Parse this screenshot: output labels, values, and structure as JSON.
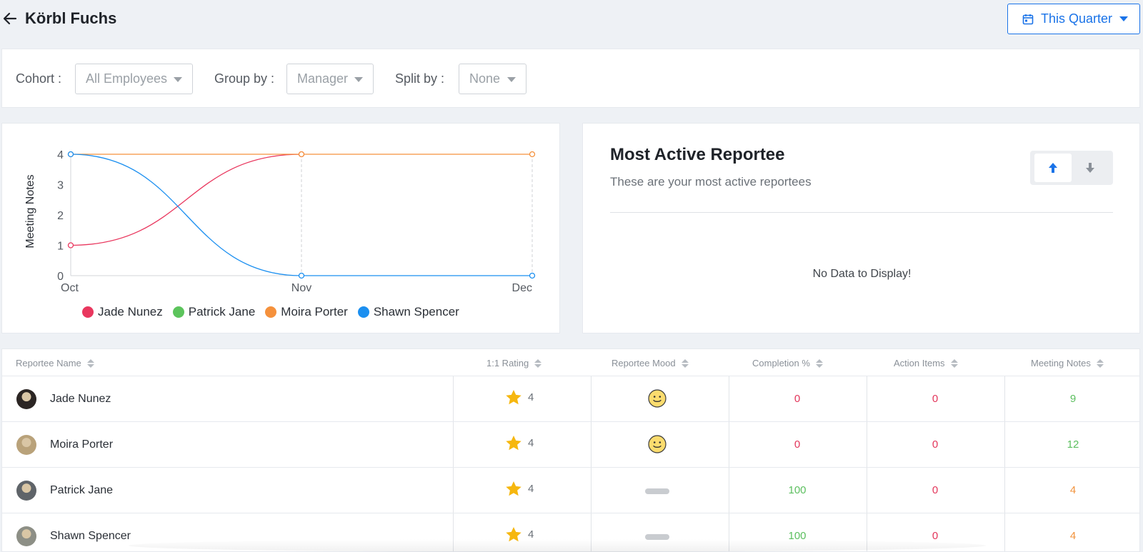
{
  "header": {
    "title": "Körbl Fuchs",
    "date_range": "This Quarter"
  },
  "filters": {
    "cohort": {
      "label": "Cohort :",
      "value": "All Employees"
    },
    "group_by": {
      "label": "Group by :",
      "value": "Manager"
    },
    "split_by": {
      "label": "Split by :",
      "value": "None"
    }
  },
  "chart_data": {
    "type": "line",
    "ylabel": "Meeting Notes",
    "x": [
      "Oct",
      "Nov",
      "Dec"
    ],
    "yticks": [
      "0",
      "1",
      "2",
      "3",
      "4"
    ],
    "ylim": [
      0,
      4
    ],
    "series": [
      {
        "name": "Jade Nunez",
        "color": "#e9375e",
        "values": [
          1,
          4,
          null
        ]
      },
      {
        "name": "Patrick Jane",
        "color": "#5cc45c",
        "values": [
          null,
          null,
          null
        ]
      },
      {
        "name": "Moira Porter",
        "color": "#f5913c",
        "values": [
          4,
          4,
          4
        ]
      },
      {
        "name": "Shawn Spencer",
        "color": "#1b8ff0",
        "values": [
          4,
          0,
          0
        ]
      }
    ],
    "grid": "vertical dashed at Nov and Dec",
    "legend": "bottom"
  },
  "active": {
    "title": "Most Active Reportee",
    "subtitle": "These are your most active reportees",
    "empty": "No Data to Display!"
  },
  "table": {
    "headers": [
      "Reportee Name",
      "1:1 Rating",
      "Reportee Mood",
      "Completion %",
      "Action Items",
      "Meeting Notes"
    ],
    "rows": [
      {
        "name": "Jade Nunez",
        "rating": "4",
        "mood": "smile",
        "completion": "0",
        "completion_color": "red",
        "action_items": "0",
        "meeting_notes": "9",
        "notes_color": "green",
        "avatar_color": "#2b2523"
      },
      {
        "name": "Moira Porter",
        "rating": "4",
        "mood": "smile",
        "completion": "0",
        "completion_color": "red",
        "action_items": "0",
        "meeting_notes": "12",
        "notes_color": "green",
        "avatar_color": "#b9a27a"
      },
      {
        "name": "Patrick Jane",
        "rating": "4",
        "mood": "none",
        "completion": "100",
        "completion_color": "green",
        "action_items": "0",
        "meeting_notes": "4",
        "notes_color": "orange",
        "avatar_color": "#5f6469"
      },
      {
        "name": "Shawn Spencer",
        "rating": "4",
        "mood": "none",
        "completion": "100",
        "completion_color": "green",
        "action_items": "0",
        "meeting_notes": "4",
        "notes_color": "orange",
        "avatar_color": "#8d8f86"
      }
    ]
  },
  "icons": {
    "back": "arrow-left-icon",
    "calendar": "calendar-icon",
    "star": "star-icon",
    "smile": "smile-icon",
    "sort_asc": "arrow-up-icon",
    "sort_desc": "arrow-down-icon"
  }
}
